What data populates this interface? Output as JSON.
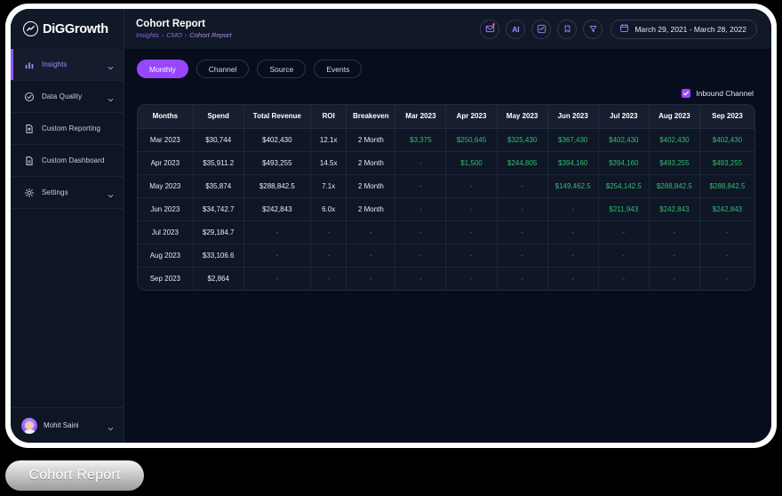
{
  "brand": {
    "name": "DiGGrowth",
    "logo_icon": "wave-circle-logo"
  },
  "header": {
    "title": "Cohort Report",
    "breadcrumb": [
      "Insights",
      "CMO",
      "Cohort Report"
    ],
    "separator": "›",
    "actions": [
      {
        "name": "mail-icon",
        "label": "",
        "badge": true
      },
      {
        "name": "ai-icon",
        "label": "AI"
      },
      {
        "name": "trend-chart-icon",
        "label": ""
      },
      {
        "name": "bookmark-icon",
        "label": ""
      },
      {
        "name": "filter-icon",
        "label": ""
      }
    ],
    "date_range": "March 29, 2021 - March 28, 2022"
  },
  "sidebar": {
    "items": [
      {
        "label": "Insights",
        "icon": "bar-chart-icon",
        "active": true,
        "chevron": true
      },
      {
        "label": "Data Quality",
        "icon": "check-circle-icon",
        "active": false,
        "chevron": true
      },
      {
        "label": "Custom Reporting",
        "icon": "file-upload-icon",
        "active": false,
        "chevron": false
      },
      {
        "label": "Custom Dashboard",
        "icon": "file-icon",
        "active": false,
        "chevron": false
      },
      {
        "label": "Settings",
        "icon": "gear-icon",
        "active": false,
        "chevron": true
      }
    ],
    "profile": {
      "name": "Mohit Saini",
      "chevron": true
    }
  },
  "main": {
    "tabs": [
      {
        "label": "Monthly",
        "active": true
      },
      {
        "label": "Channel",
        "active": false
      },
      {
        "label": "Source",
        "active": false
      },
      {
        "label": "Events",
        "active": false
      }
    ],
    "legend": {
      "label": "Inbound Channel",
      "checked": true
    }
  },
  "colors": {
    "accent": "#9747ff",
    "money": "#2fbf71",
    "app_bg": "#070d1c",
    "panel_bg": "#0f1626",
    "header_bg": "#161e2f"
  },
  "chart_data": {
    "type": "table",
    "title": "Cohort Report",
    "columns": [
      "Months",
      "Spend",
      "Total Revenue",
      "ROI",
      "Breakeven",
      "Mar 2023",
      "Apr 2023",
      "May 2023",
      "Jun 2023",
      "Jul 2023",
      "Aug 2023",
      "Sep 2023"
    ],
    "rows": [
      {
        "cells": [
          "Mar 2023",
          "$30,744",
          "$402,430",
          "12.1x",
          "2 Month",
          "$3,375",
          "$250,645",
          "$325,430",
          "$367,430",
          "$402,430",
          "$402,430",
          "$402,430"
        ],
        "kinds": [
          "first",
          "first",
          "first",
          "first",
          "first",
          "money",
          "money",
          "money",
          "money",
          "money",
          "money",
          "money"
        ]
      },
      {
        "cells": [
          "Apr 2023",
          "$35,911.2",
          "$493,255",
          "14.5x",
          "2 Month",
          "-",
          "$1,500",
          "$244,805",
          "$394,160",
          "$394,160",
          "$493,255",
          "$493,255"
        ],
        "kinds": [
          "first",
          "first",
          "first",
          "first",
          "first",
          "dash",
          "money",
          "money",
          "money",
          "money",
          "money",
          "money"
        ]
      },
      {
        "cells": [
          "May 2023",
          "$35,874",
          "$288,842.5",
          "7.1x",
          "2 Month",
          "-",
          "-",
          "-",
          "$149,462.5",
          "$254,142.5",
          "$288,842.5",
          "$288,842.5"
        ],
        "kinds": [
          "first",
          "first",
          "first",
          "first",
          "first",
          "dash",
          "dash",
          "dash",
          "money",
          "money",
          "money",
          "money"
        ]
      },
      {
        "cells": [
          "Jun 2023",
          "$34,742.7",
          "$242,843",
          "6.0x",
          "2 Month",
          "-",
          "-",
          "-",
          "-",
          "$211,943",
          "$242,843",
          "$242,843"
        ],
        "kinds": [
          "first",
          "first",
          "first",
          "first",
          "first",
          "dash",
          "dash",
          "dash",
          "dash",
          "money",
          "money",
          "money"
        ]
      },
      {
        "cells": [
          "Jul 2023",
          "$29,184.7",
          "-",
          "-",
          "-",
          "-",
          "-",
          "-",
          "-",
          "-",
          "-",
          "-"
        ],
        "kinds": [
          "first",
          "first",
          "dash",
          "dash",
          "dash",
          "dash",
          "dash",
          "dash",
          "dash",
          "dash",
          "dash",
          "dash"
        ]
      },
      {
        "cells": [
          "Aug 2023",
          "$33,106.6",
          "-",
          "-",
          "-",
          "-",
          "-",
          "-",
          "-",
          "-",
          "-",
          "-"
        ],
        "kinds": [
          "first",
          "first",
          "dash",
          "dash",
          "dash",
          "dash",
          "dash",
          "dash",
          "dash",
          "dash",
          "dash",
          "dash"
        ]
      },
      {
        "cells": [
          "Sep 2023",
          "$2,864",
          "-",
          "-",
          "-",
          "-",
          "-",
          "-",
          "-",
          "-",
          "-",
          "-"
        ],
        "kinds": [
          "first",
          "first",
          "dash",
          "dash",
          "dash",
          "dash",
          "dash",
          "dash",
          "dash",
          "dash",
          "dash",
          "dash"
        ]
      }
    ]
  },
  "caption": {
    "label": "Cohort Report"
  }
}
